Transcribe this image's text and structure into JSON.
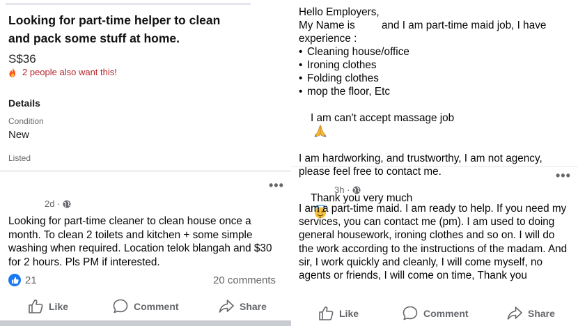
{
  "listing": {
    "title": "Looking for part-time helper to clean and pack some stuff at home.",
    "price": "S$36",
    "interest_text": "2 people also want this!",
    "details_heading": "Details",
    "condition_label": "Condition",
    "condition_value": "New",
    "listed_label": "Listed"
  },
  "post_left": {
    "time": "2d ·",
    "text": "Looking for part-time cleaner to clean house once a month. To clean 2 toilets and kitchen + some simple washing when required. Location telok blangah and $30 for 2 hours. Pls PM if interested.",
    "like_count": "21",
    "comment_count": "20 comments",
    "actions": {
      "like": "Like",
      "comment": "Comment",
      "share": "Share"
    }
  },
  "post_right_top": {
    "lines": [
      "Hello Employers,",
      "My Name is         and I am part-time maid job, I have",
      "experience :",
      "Cleaning house/office",
      "Ironing clothes",
      "Folding clothes",
      "mop the floor, Etc",
      "I am can't accept massage job",
      "I am hardworking, and trustworthy, I am not agency,",
      "please feel free to contact me.",
      "Thank you very much"
    ]
  },
  "post_right": {
    "time": "3h ·",
    "text": "I am a part-time maid. I am ready to help. If you need my services, you can contact me (pm). I am used to doing general housework, ironing clothes and so on. I will do the work according to the instructions of the madam. And sir, I work quickly and cleanly, I will come myself, no agents or friends, I will come on time, Thank you",
    "actions": {
      "like": "Like",
      "comment": "Comment",
      "share": "Share"
    }
  },
  "icons": {
    "like": "thumbs-up-icon",
    "comment": "speech-bubble-icon",
    "share": "share-arrow-icon",
    "audience": "globe-icon",
    "more": "more-options-icon",
    "fire": "fire-icon",
    "pray": "folded-hands-emoji",
    "smile": "smiling-halo-emoji"
  },
  "colors": {
    "facebook_blue": "#1877f2",
    "interest_red": "#b3242b",
    "secondary_text": "#65676b"
  }
}
